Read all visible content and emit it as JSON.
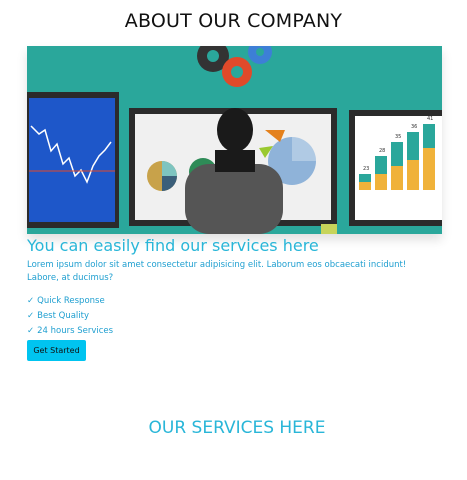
{
  "header": {
    "title": "ABOUT OUR COMPANY"
  },
  "hero": {
    "bg_color": "#2aa79b",
    "chart_numbers": [
      "35",
      "36",
      "41",
      "23",
      "28"
    ]
  },
  "about": {
    "heading": "You can easily find our services here",
    "description": "Lorem ipsum dolor sit amet consectetur adipisicing elit. Laborum eos obcaecati incidunt! Labore, at ducimus?",
    "features": [
      {
        "check": "✓",
        "label": "Quick Response"
      },
      {
        "check": "✓",
        "label": "Best Quality"
      },
      {
        "check": "✓",
        "label": "24 hours Services"
      }
    ],
    "cta_label": "Get Started"
  },
  "services": {
    "title": "OUR SERVICES HERE"
  },
  "colors": {
    "accent": "#29b6d8",
    "button": "#00c4f0",
    "text_dark": "#111111"
  }
}
